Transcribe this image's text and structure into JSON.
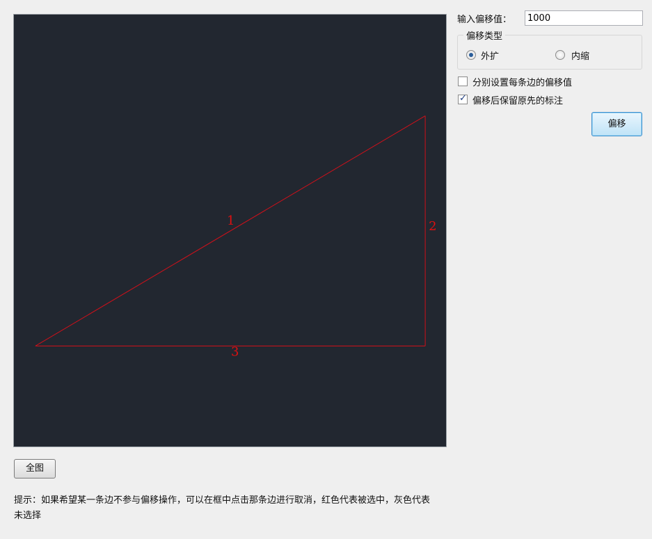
{
  "panel": {
    "offset_label": "输入偏移值：",
    "offset_value": "1000",
    "offset_type": {
      "title": "偏移类型",
      "options": [
        {
          "label": "外扩",
          "selected": true
        },
        {
          "label": "内缩",
          "selected": false
        }
      ]
    },
    "checkboxes": [
      {
        "label": "分别设置每条边的偏移值",
        "checked": false
      },
      {
        "label": "偏移后保留原先的标注",
        "checked": true
      }
    ],
    "offset_button": "偏移"
  },
  "canvas": {
    "background": "#222730",
    "edge_color": "#d0101a",
    "edges": [
      {
        "label": "1",
        "selected": true
      },
      {
        "label": "2",
        "selected": true
      },
      {
        "label": "3",
        "selected": true
      }
    ]
  },
  "fit_button": "全图",
  "hint": "提示：如果希望某一条边不参与偏移操作，可以在框中点击那条边进行取消，红色代表被选中，灰色代表未选择"
}
